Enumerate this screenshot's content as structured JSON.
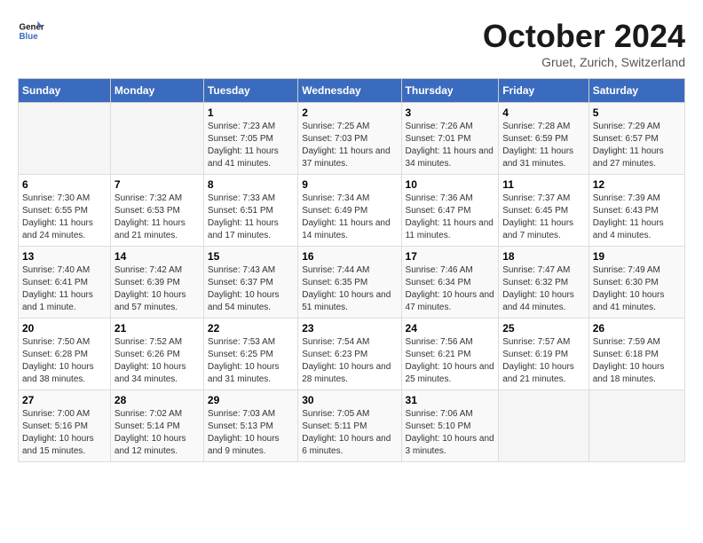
{
  "logo": {
    "text_general": "General",
    "text_blue": "Blue"
  },
  "title": "October 2024",
  "location": "Gruet, Zurich, Switzerland",
  "days_of_week": [
    "Sunday",
    "Monday",
    "Tuesday",
    "Wednesday",
    "Thursday",
    "Friday",
    "Saturday"
  ],
  "weeks": [
    [
      {
        "day": "",
        "sunrise": "",
        "sunset": "",
        "daylight": ""
      },
      {
        "day": "",
        "sunrise": "",
        "sunset": "",
        "daylight": ""
      },
      {
        "day": "1",
        "sunrise": "Sunrise: 7:23 AM",
        "sunset": "Sunset: 7:05 PM",
        "daylight": "Daylight: 11 hours and 41 minutes."
      },
      {
        "day": "2",
        "sunrise": "Sunrise: 7:25 AM",
        "sunset": "Sunset: 7:03 PM",
        "daylight": "Daylight: 11 hours and 37 minutes."
      },
      {
        "day": "3",
        "sunrise": "Sunrise: 7:26 AM",
        "sunset": "Sunset: 7:01 PM",
        "daylight": "Daylight: 11 hours and 34 minutes."
      },
      {
        "day": "4",
        "sunrise": "Sunrise: 7:28 AM",
        "sunset": "Sunset: 6:59 PM",
        "daylight": "Daylight: 11 hours and 31 minutes."
      },
      {
        "day": "5",
        "sunrise": "Sunrise: 7:29 AM",
        "sunset": "Sunset: 6:57 PM",
        "daylight": "Daylight: 11 hours and 27 minutes."
      }
    ],
    [
      {
        "day": "6",
        "sunrise": "Sunrise: 7:30 AM",
        "sunset": "Sunset: 6:55 PM",
        "daylight": "Daylight: 11 hours and 24 minutes."
      },
      {
        "day": "7",
        "sunrise": "Sunrise: 7:32 AM",
        "sunset": "Sunset: 6:53 PM",
        "daylight": "Daylight: 11 hours and 21 minutes."
      },
      {
        "day": "8",
        "sunrise": "Sunrise: 7:33 AM",
        "sunset": "Sunset: 6:51 PM",
        "daylight": "Daylight: 11 hours and 17 minutes."
      },
      {
        "day": "9",
        "sunrise": "Sunrise: 7:34 AM",
        "sunset": "Sunset: 6:49 PM",
        "daylight": "Daylight: 11 hours and 14 minutes."
      },
      {
        "day": "10",
        "sunrise": "Sunrise: 7:36 AM",
        "sunset": "Sunset: 6:47 PM",
        "daylight": "Daylight: 11 hours and 11 minutes."
      },
      {
        "day": "11",
        "sunrise": "Sunrise: 7:37 AM",
        "sunset": "Sunset: 6:45 PM",
        "daylight": "Daylight: 11 hours and 7 minutes."
      },
      {
        "day": "12",
        "sunrise": "Sunrise: 7:39 AM",
        "sunset": "Sunset: 6:43 PM",
        "daylight": "Daylight: 11 hours and 4 minutes."
      }
    ],
    [
      {
        "day": "13",
        "sunrise": "Sunrise: 7:40 AM",
        "sunset": "Sunset: 6:41 PM",
        "daylight": "Daylight: 11 hours and 1 minute."
      },
      {
        "day": "14",
        "sunrise": "Sunrise: 7:42 AM",
        "sunset": "Sunset: 6:39 PM",
        "daylight": "Daylight: 10 hours and 57 minutes."
      },
      {
        "day": "15",
        "sunrise": "Sunrise: 7:43 AM",
        "sunset": "Sunset: 6:37 PM",
        "daylight": "Daylight: 10 hours and 54 minutes."
      },
      {
        "day": "16",
        "sunrise": "Sunrise: 7:44 AM",
        "sunset": "Sunset: 6:35 PM",
        "daylight": "Daylight: 10 hours and 51 minutes."
      },
      {
        "day": "17",
        "sunrise": "Sunrise: 7:46 AM",
        "sunset": "Sunset: 6:34 PM",
        "daylight": "Daylight: 10 hours and 47 minutes."
      },
      {
        "day": "18",
        "sunrise": "Sunrise: 7:47 AM",
        "sunset": "Sunset: 6:32 PM",
        "daylight": "Daylight: 10 hours and 44 minutes."
      },
      {
        "day": "19",
        "sunrise": "Sunrise: 7:49 AM",
        "sunset": "Sunset: 6:30 PM",
        "daylight": "Daylight: 10 hours and 41 minutes."
      }
    ],
    [
      {
        "day": "20",
        "sunrise": "Sunrise: 7:50 AM",
        "sunset": "Sunset: 6:28 PM",
        "daylight": "Daylight: 10 hours and 38 minutes."
      },
      {
        "day": "21",
        "sunrise": "Sunrise: 7:52 AM",
        "sunset": "Sunset: 6:26 PM",
        "daylight": "Daylight: 10 hours and 34 minutes."
      },
      {
        "day": "22",
        "sunrise": "Sunrise: 7:53 AM",
        "sunset": "Sunset: 6:25 PM",
        "daylight": "Daylight: 10 hours and 31 minutes."
      },
      {
        "day": "23",
        "sunrise": "Sunrise: 7:54 AM",
        "sunset": "Sunset: 6:23 PM",
        "daylight": "Daylight: 10 hours and 28 minutes."
      },
      {
        "day": "24",
        "sunrise": "Sunrise: 7:56 AM",
        "sunset": "Sunset: 6:21 PM",
        "daylight": "Daylight: 10 hours and 25 minutes."
      },
      {
        "day": "25",
        "sunrise": "Sunrise: 7:57 AM",
        "sunset": "Sunset: 6:19 PM",
        "daylight": "Daylight: 10 hours and 21 minutes."
      },
      {
        "day": "26",
        "sunrise": "Sunrise: 7:59 AM",
        "sunset": "Sunset: 6:18 PM",
        "daylight": "Daylight: 10 hours and 18 minutes."
      }
    ],
    [
      {
        "day": "27",
        "sunrise": "Sunrise: 7:00 AM",
        "sunset": "Sunset: 5:16 PM",
        "daylight": "Daylight: 10 hours and 15 minutes."
      },
      {
        "day": "28",
        "sunrise": "Sunrise: 7:02 AM",
        "sunset": "Sunset: 5:14 PM",
        "daylight": "Daylight: 10 hours and 12 minutes."
      },
      {
        "day": "29",
        "sunrise": "Sunrise: 7:03 AM",
        "sunset": "Sunset: 5:13 PM",
        "daylight": "Daylight: 10 hours and 9 minutes."
      },
      {
        "day": "30",
        "sunrise": "Sunrise: 7:05 AM",
        "sunset": "Sunset: 5:11 PM",
        "daylight": "Daylight: 10 hours and 6 minutes."
      },
      {
        "day": "31",
        "sunrise": "Sunrise: 7:06 AM",
        "sunset": "Sunset: 5:10 PM",
        "daylight": "Daylight: 10 hours and 3 minutes."
      },
      {
        "day": "",
        "sunrise": "",
        "sunset": "",
        "daylight": ""
      },
      {
        "day": "",
        "sunrise": "",
        "sunset": "",
        "daylight": ""
      }
    ]
  ]
}
